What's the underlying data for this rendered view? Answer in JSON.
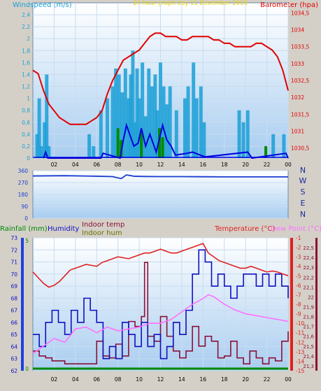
{
  "colors": {
    "wind": "#1a9fd6",
    "wind_gust": "#0a7fb8",
    "wind_avg": "#0000e0",
    "wind_green": "#008a00",
    "barometer": "#e00000",
    "direction": "#1a3cd0",
    "temperature": "#e02020",
    "dewpoint": "#ff70ff",
    "indoor_temp": "#8a1038",
    "indoor_hum": "#6a7000",
    "humidity": "#1010c0",
    "rainfall": "#008800",
    "title": "#e8d000"
  },
  "chart_data": [
    {
      "type": "line",
      "title": "24 hour graph day 11 December 2016",
      "ylabel_left": "Windspeed (m/s)",
      "ylabel_right": "Barometer (hpa)",
      "x_ticks": [
        "02",
        "04",
        "06",
        "08",
        "10",
        "12",
        "14",
        "16",
        "18",
        "20",
        "22",
        "00"
      ],
      "x_range": [
        0,
        24
      ],
      "y_left_range": [
        0,
        2.6
      ],
      "y_left_ticks": [
        "0",
        "0,2",
        "0,4",
        "0,6",
        "0,8",
        "1",
        "1,2",
        "1,4",
        "1,6",
        "1,8",
        "2",
        "2,2",
        "2,4"
      ],
      "y_right_range": [
        1030.2,
        1034.8
      ],
      "y_right_ticks": [
        "1030,5",
        "1031",
        "1031,5",
        "1032",
        "1032,5",
        "1033",
        "1033,5",
        "1034",
        "1034,5"
      ],
      "series": [
        {
          "name": "Barometer",
          "x": [
            0,
            0.5,
            1,
            1.5,
            2,
            2.5,
            3,
            3.5,
            4,
            4.5,
            5,
            5.5,
            6,
            6.5,
            7,
            7.5,
            8,
            8.5,
            9,
            9.5,
            10,
            10.5,
            11,
            11.5,
            12,
            12.5,
            13,
            13.5,
            14,
            14.5,
            15,
            15.5,
            16,
            16.5,
            17,
            17.5,
            18,
            18.5,
            19,
            19.5,
            20,
            20.5,
            21,
            21.5,
            22,
            22.5,
            23,
            23.5,
            24
          ],
          "y": [
            1032.8,
            1032.7,
            1032.2,
            1031.8,
            1031.6,
            1031.4,
            1031.3,
            1031.2,
            1031.2,
            1031.2,
            1031.2,
            1031.3,
            1031.4,
            1031.6,
            1032.1,
            1032.5,
            1032.8,
            1033.1,
            1033.2,
            1033.3,
            1033.4,
            1033.6,
            1033.8,
            1033.9,
            1033.9,
            1033.8,
            1033.8,
            1033.8,
            1033.7,
            1033.7,
            1033.8,
            1033.8,
            1033.8,
            1033.8,
            1033.7,
            1033.7,
            1033.6,
            1033.6,
            1033.5,
            1033.5,
            1033.5,
            1033.5,
            1033.6,
            1033.6,
            1033.5,
            1033.4,
            1033.2,
            1032.8,
            1032.2
          ]
        },
        {
          "name": "Gust",
          "x": [
            0.4,
            0.6,
            0.8,
            1.1,
            1.3,
            1.5,
            5.3,
            5.7,
            6.4,
            7.0,
            7.5,
            7.8,
            8.1,
            8.4,
            8.7,
            9.0,
            9.2,
            9.4,
            9.6,
            9.8,
            10.0,
            10.3,
            10.6,
            10.9,
            11.2,
            11.5,
            11.7,
            12.0,
            12.3,
            12.6,
            12.9,
            13.5,
            14.3,
            14.6,
            15.1,
            15.4,
            15.8,
            16.1,
            19.4,
            19.8,
            20.2,
            22.6,
            23.6
          ],
          "y": [
            0.4,
            1.0,
            0.2,
            0.6,
            1.4,
            0.2,
            0.4,
            0.2,
            0.8,
            1.0,
            1.2,
            1.5,
            1.4,
            1.1,
            1.5,
            1.0,
            1.4,
            1.8,
            0.6,
            1.5,
            1.0,
            1.6,
            0.7,
            1.5,
            1.2,
            1.4,
            0.8,
            1.6,
            1.2,
            0.9,
            1.2,
            0.8,
            1.0,
            1.2,
            1.6,
            1.0,
            1.2,
            0.6,
            0.8,
            0.6,
            0.8,
            0.4,
            0.4
          ]
        },
        {
          "name": "Average",
          "x": [
            1.0,
            1.2,
            1.4,
            6.4,
            6.6,
            8.2,
            8.5,
            8.8,
            9.5,
            9.9,
            10.2,
            10.6,
            11.0,
            11.3,
            11.6,
            12.2,
            12.6,
            13.0,
            13.4,
            14.5,
            15.0,
            15.6,
            16.2,
            20.2,
            20.6,
            23.8,
            24
          ],
          "y": [
            0,
            0.1,
            0,
            0,
            0.08,
            0,
            0.3,
            0.55,
            0.2,
            0.25,
            0.5,
            0.2,
            0.4,
            0.25,
            0.1,
            0.55,
            0.3,
            0.2,
            0.05,
            0.08,
            0.1,
            0.06,
            0.02,
            0.1,
            0,
            0.08,
            0
          ]
        }
      ]
    },
    {
      "type": "line",
      "title": "",
      "ylabel_right": "N W S E N",
      "x_range": [
        0,
        24
      ],
      "y_range": [
        0,
        360
      ],
      "y_ticks": [
        "0",
        "90",
        "180",
        "270",
        "360"
      ],
      "series": [
        {
          "name": "Direction",
          "x": [
            0,
            3,
            6,
            7.5,
            8.3,
            8.8,
            9.5,
            10.5,
            12,
            14,
            16,
            18,
            20,
            22,
            24
          ],
          "y": [
            320,
            322,
            318,
            315,
            300,
            328,
            318,
            316,
            315,
            315,
            314,
            313,
            313,
            313,
            313
          ]
        }
      ]
    },
    {
      "type": "line",
      "title": "",
      "legend_left": [
        "Rainfall (mm)",
        "Humidity"
      ],
      "legend_center": [
        "Indoor temp",
        "Indoor hum"
      ],
      "legend_right": [
        "Temperature (°C)",
        "Dew Point (°C)"
      ],
      "x_ticks": [
        "02",
        "04",
        "06",
        "08",
        "10",
        "12",
        "14",
        "16",
        "18",
        "20",
        "22",
        "00"
      ],
      "x_range": [
        0,
        24
      ],
      "humidity_range": [
        62,
        73
      ],
      "humidity_ticks": [
        "62",
        "63",
        "64",
        "65",
        "66",
        "67",
        "68",
        "69",
        "70",
        "71",
        "72",
        "73"
      ],
      "rain_ticks": [
        "0",
        "5"
      ],
      "temp_range": [
        -15,
        -1
      ],
      "temp_ticks": [
        "-1",
        "-2",
        "-3",
        "-4",
        "-5",
        "-6",
        "-7",
        "-8",
        "-9",
        "-10",
        "-11",
        "-12",
        "-13",
        "-14",
        "-15"
      ],
      "indoor_ticks": [
        "22,5",
        "22,4",
        "22,3",
        "22,2",
        "22,1",
        "22",
        "21,9",
        "21,8",
        "21,7",
        "21,6",
        "21,5",
        "21,4",
        "21,3"
      ],
      "series": [
        {
          "name": "Temperature (°C)",
          "x": [
            0,
            0.5,
            1,
            1.5,
            2,
            2.5,
            3,
            3.5,
            4,
            4.5,
            5,
            5.5,
            6,
            6.5,
            7,
            7.5,
            8,
            8.5,
            9,
            9.5,
            10,
            10.5,
            11,
            11.5,
            12,
            12.5,
            13,
            13.5,
            14,
            14.5,
            15,
            15.5,
            16,
            16.5,
            17,
            17.5,
            18,
            18.5,
            19,
            19.5,
            20,
            20.5,
            21,
            21.5,
            22,
            22.5,
            23,
            23.5,
            24
          ],
          "y": [
            -4.6,
            -5.2,
            -5.8,
            -6.2,
            -6.0,
            -5.6,
            -5.0,
            -4.4,
            -4.2,
            -4.0,
            -3.8,
            -3.9,
            -4.0,
            -3.6,
            -3.4,
            -3.2,
            -3.0,
            -3.1,
            -3.2,
            -3.0,
            -2.8,
            -2.6,
            -2.6,
            -2.4,
            -2.2,
            -2.4,
            -2.6,
            -2.6,
            -2.4,
            -2.2,
            -2.0,
            -1.8,
            -1.6,
            -2.6,
            -3.0,
            -3.4,
            -3.6,
            -3.8,
            -4.0,
            -4.2,
            -4.2,
            -4.0,
            -4.2,
            -4.4,
            -4.6,
            -4.5,
            -4.6,
            -4.8,
            -5.0
          ]
        },
        {
          "name": "Dew Point (°C)",
          "x": [
            0,
            1,
            2,
            3,
            4,
            5,
            6,
            7,
            8,
            9,
            10,
            11,
            12,
            13,
            14,
            15,
            16,
            16.5,
            17,
            18,
            19,
            20,
            21,
            22,
            23,
            24
          ],
          "y": [
            -13.2,
            -12.4,
            -11.6,
            -12.0,
            -10.6,
            -10.4,
            -11.0,
            -10.4,
            -10.8,
            -10.6,
            -10.4,
            -10.0,
            -10.0,
            -9.6,
            -8.8,
            -8.0,
            -7.4,
            -7.0,
            -7.2,
            -8.0,
            -8.6,
            -9.0,
            -9.2,
            -9.4,
            -9.6,
            -9.8
          ]
        },
        {
          "name": "Humidity",
          "x": [
            0,
            0.6,
            1.2,
            1.8,
            2.4,
            3.0,
            3.6,
            4.2,
            4.8,
            5.4,
            6.0,
            6.6,
            7.2,
            7.8,
            8.4,
            9.0,
            9.6,
            10.2,
            10.8,
            11.4,
            12.0,
            12.6,
            13.2,
            13.8,
            14.4,
            15.0,
            15.6,
            16.2,
            16.8,
            17.4,
            18.0,
            18.6,
            19.2,
            19.8,
            20.4,
            21.0,
            21.6,
            22.2,
            22.8,
            23.4,
            24
          ],
          "y": [
            65,
            64,
            66,
            67,
            66,
            65,
            67,
            66,
            68,
            67,
            66,
            63,
            64,
            63,
            66,
            65,
            64,
            66,
            64,
            65,
            63,
            64,
            66,
            65,
            67,
            70,
            72,
            71,
            69,
            70,
            69,
            68,
            69,
            70,
            70,
            69,
            70,
            69,
            70,
            69,
            68
          ]
        },
        {
          "name": "Indoor temp",
          "x": [
            0,
            0.6,
            1.2,
            1.8,
            2.4,
            3.0,
            3.6,
            4.2,
            4.8,
            5.4,
            6.0,
            6.6,
            7.2,
            7.8,
            8.4,
            9.0,
            9.6,
            10.2,
            10.5,
            10.8,
            11.4,
            12.0,
            12.6,
            13.2,
            13.8,
            14.4,
            15.0,
            15.6,
            16.2,
            16.8,
            17.4,
            18.0,
            18.6,
            19.2,
            19.8,
            20.4,
            21.0,
            21.6,
            22.2,
            22.8,
            23.4,
            24
          ],
          "y": [
            21.45,
            21.4,
            21.38,
            21.35,
            21.35,
            21.32,
            21.32,
            21.32,
            21.32,
            21.32,
            21.55,
            21.4,
            21.38,
            21.52,
            21.4,
            21.75,
            21.7,
            21.8,
            22.35,
            21.6,
            21.55,
            21.8,
            21.6,
            21.45,
            21.38,
            21.45,
            21.7,
            21.5,
            21.6,
            21.55,
            21.38,
            21.4,
            21.55,
            21.38,
            21.32,
            21.45,
            21.38,
            21.32,
            21.38,
            21.35,
            21.55,
            21.65
          ]
        },
        {
          "name": "Rainfall (mm)",
          "x": [
            0,
            24
          ],
          "y": [
            0,
            0
          ]
        }
      ]
    }
  ]
}
